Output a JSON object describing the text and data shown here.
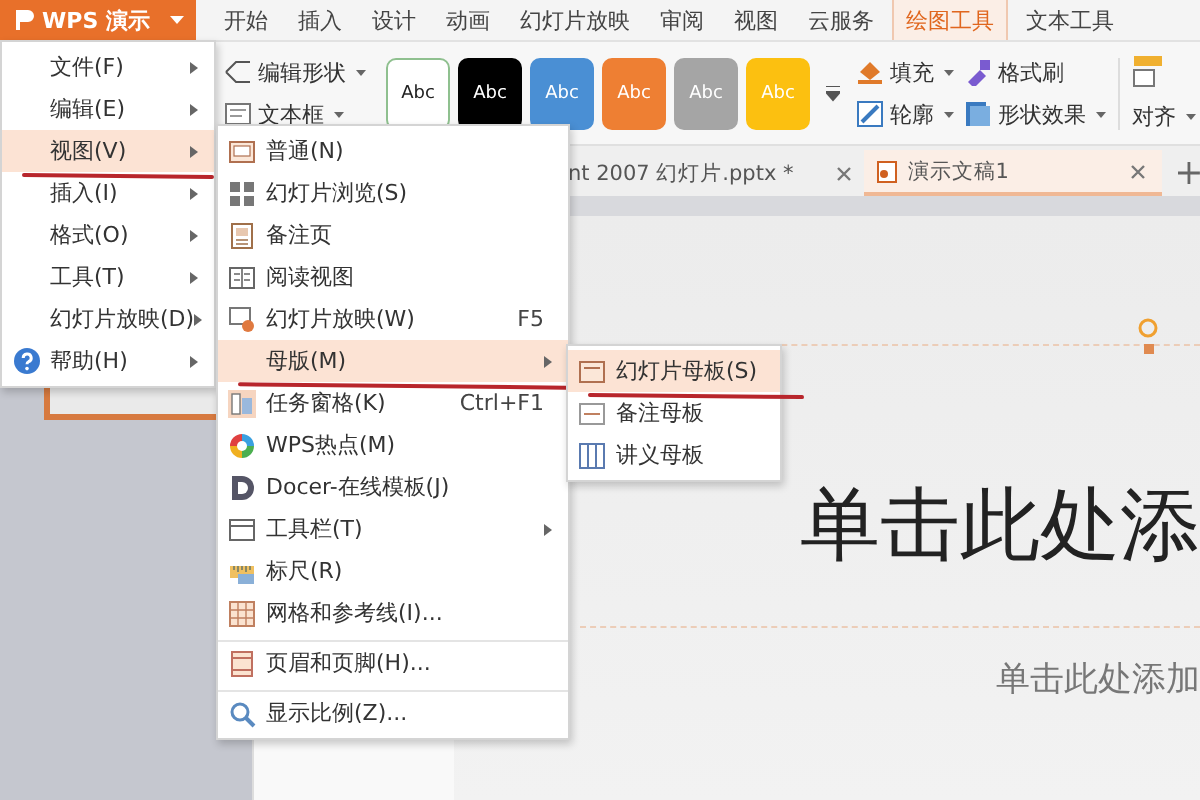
{
  "app_button": {
    "label": "WPS 演示"
  },
  "ribbon_tabs": [
    {
      "label": "开始",
      "selected": false
    },
    {
      "label": "插入",
      "selected": false
    },
    {
      "label": "设计",
      "selected": false
    },
    {
      "label": "动画",
      "selected": false
    },
    {
      "label": "幻灯片放映",
      "selected": false
    },
    {
      "label": "审阅",
      "selected": false
    },
    {
      "label": "视图",
      "selected": false
    },
    {
      "label": "云服务",
      "selected": false
    },
    {
      "label": "绘图工具",
      "selected": true
    },
    {
      "label": "文本工具",
      "selected": false
    }
  ],
  "ribbon": {
    "shape_tools": [
      "编辑形状",
      "文本框"
    ],
    "style_swatches": [
      {
        "label": "Abc",
        "color": "#ffffff"
      },
      {
        "label": "Abc",
        "color": "#000000"
      },
      {
        "label": "Abc",
        "color": "#4a8fd4"
      },
      {
        "label": "Abc",
        "color": "#ee7f33"
      },
      {
        "label": "Abc",
        "color": "#a5a5a5"
      },
      {
        "label": "Abc",
        "color": "#fcc010"
      }
    ],
    "format_tools": [
      "填充",
      "格式刷",
      "轮廓",
      "形状效果"
    ],
    "align_label": "对齐"
  },
  "doc_tabs": [
    {
      "title": "nt 2007 幻灯片.pptx *",
      "selected": false
    },
    {
      "title": "演示文稿1",
      "selected": true
    }
  ],
  "slide": {
    "title": "单击此处添",
    "subtitle": "单击此处添加"
  },
  "main_menu": [
    {
      "label": "文件(F)",
      "selected": false,
      "underlined": false
    },
    {
      "label": "编辑(E)",
      "selected": false,
      "underlined": false
    },
    {
      "label": "视图(V)",
      "selected": true,
      "underlined": true
    },
    {
      "label": "插入(I)",
      "selected": false,
      "underlined": false
    },
    {
      "label": "格式(O)",
      "selected": false,
      "underlined": false
    },
    {
      "label": "工具(T)",
      "selected": false,
      "underlined": false
    },
    {
      "label": "幻灯片放映(D)",
      "selected": false,
      "underlined": false
    },
    {
      "label": "帮助(H)",
      "selected": false,
      "underlined": false
    }
  ],
  "view_menu": [
    {
      "label": "普通(N)",
      "selected": false,
      "underlined": false,
      "submenu": false,
      "separator_before": false
    },
    {
      "label": "幻灯片浏览(S)",
      "selected": false,
      "underlined": false,
      "submenu": false,
      "separator_before": false
    },
    {
      "label": "备注页",
      "selected": false,
      "underlined": false,
      "submenu": false,
      "separator_before": false
    },
    {
      "label": "阅读视图",
      "selected": false,
      "underlined": false,
      "submenu": false,
      "separator_before": false
    },
    {
      "label": "幻灯片放映(W)",
      "shortcut": "F5",
      "selected": false,
      "underlined": false,
      "submenu": false,
      "separator_before": false
    },
    {
      "label": "母版(M)",
      "selected": true,
      "underlined": true,
      "submenu": true,
      "separator_before": false
    },
    {
      "label": "任务窗格(K)",
      "shortcut": "Ctrl+F1",
      "selected": false,
      "underlined": false,
      "submenu": false,
      "separator_before": false
    },
    {
      "label": "WPS热点(M)",
      "selected": false,
      "underlined": false,
      "submenu": false,
      "separator_before": false
    },
    {
      "label": "Docer-在线模板(J)",
      "selected": false,
      "underlined": false,
      "submenu": false,
      "separator_before": false
    },
    {
      "label": "工具栏(T)",
      "selected": false,
      "underlined": false,
      "submenu": true,
      "separator_before": false
    },
    {
      "label": "标尺(R)",
      "selected": false,
      "underlined": false,
      "submenu": false,
      "separator_before": false
    },
    {
      "label": "网格和参考线(I)...",
      "selected": false,
      "underlined": false,
      "submenu": false,
      "separator_before": false
    },
    {
      "label": "页眉和页脚(H)...",
      "selected": false,
      "underlined": false,
      "submenu": false,
      "separator_before": true
    },
    {
      "label": "显示比例(Z)...",
      "selected": false,
      "underlined": false,
      "submenu": false,
      "separator_before": true
    }
  ],
  "master_menu": [
    {
      "label": "幻灯片母板(S)",
      "selected": true,
      "underlined": true
    },
    {
      "label": "备注母板",
      "selected": false,
      "underlined": false
    },
    {
      "label": "讲义母板",
      "selected": false,
      "underlined": false
    }
  ]
}
